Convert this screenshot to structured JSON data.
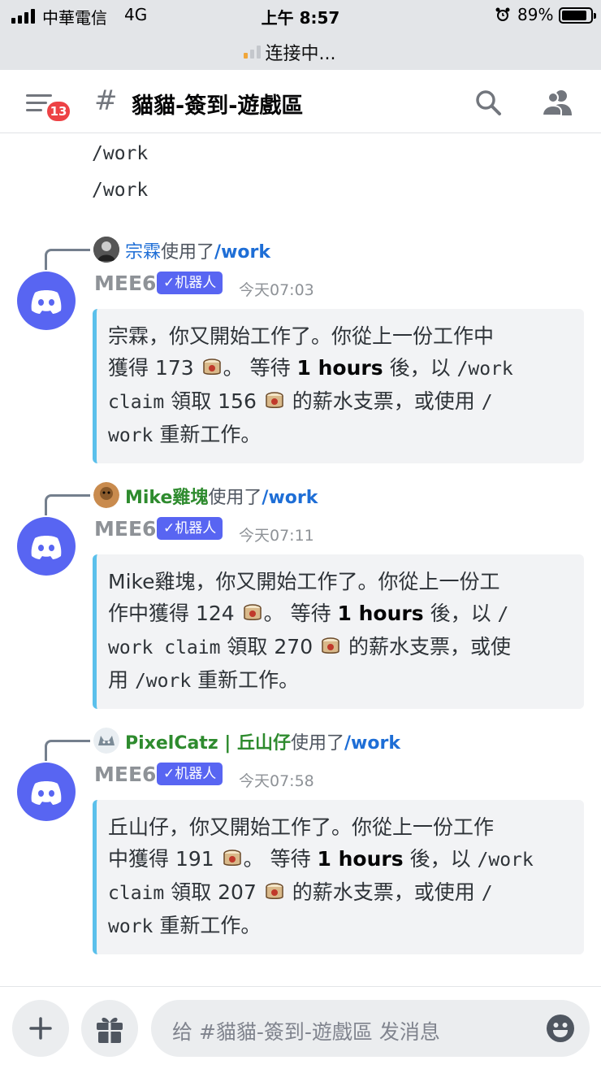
{
  "status_bar": {
    "carrier": "中華電信",
    "network": "4G",
    "time": "上午 8:57",
    "battery": "89%",
    "battery_level": 0.89,
    "connection_status": "连接中..."
  },
  "header": {
    "unread_badge": "13",
    "channel_hash": "#",
    "channel_name": "貓貓-簽到-遊戲區"
  },
  "earlier_messages": [
    "/work",
    "/work"
  ],
  "messages": [
    {
      "reply_user": "宗霖",
      "reply_user_color": "#1e6ed6",
      "reply_used": "使用了",
      "reply_command": "/work",
      "author": "MEE6",
      "bot_tag": "✓机器人",
      "timestamp": "今天07:03",
      "lines": {
        "l1": "宗霖，你又開始工作了。你從上一份工作中",
        "l2a": "獲得 173 ",
        "l2b": "。 等待 ",
        "l2c": "1 hours",
        "l2d": " 後，以 ",
        "l2e": "/work",
        "l3a": "claim",
        "l3b": " 領取 156 ",
        "l3c": " 的薪水支票，或使用 ",
        "l3d": "/",
        "l4a": "work",
        "l4b": " 重新工作。"
      }
    },
    {
      "reply_user": "Mike雞塊",
      "reply_user_color": "#2e8b2e",
      "reply_used": "使用了",
      "reply_command": "/work",
      "author": "MEE6",
      "bot_tag": "✓机器人",
      "timestamp": "今天07:11",
      "lines": {
        "l1": "Mike雞塊，你又開始工作了。你從上一份工",
        "l2a": "作中獲得 124 ",
        "l2b": "。 等待 ",
        "l2c": "1 hours",
        "l2d": " 後，以 ",
        "l2e": "/",
        "l3a": "work claim",
        "l3b": " 領取 270 ",
        "l3c": " 的薪水支票，或使",
        "l4a": "用 ",
        "l4b": "/work",
        "l4c": " 重新工作。"
      }
    },
    {
      "reply_user": "PixelCatz | 丘山仔",
      "reply_user_color": "#2e8b2e",
      "reply_used": "使用了",
      "reply_command": "/work",
      "author": "MEE6",
      "bot_tag": "✓机器人",
      "timestamp": "今天07:58",
      "lines": {
        "l1": "丘山仔，你又開始工作了。你從上一份工作",
        "l2a": "中獲得 191 ",
        "l2b": "。 等待 ",
        "l2c": "1 hours",
        "l2d": " 後，以 ",
        "l2e": "/work",
        "l3a": "claim",
        "l3b": " 領取 207 ",
        "l3c": " 的薪水支票，或使用 ",
        "l3d": "/",
        "l4a": "work",
        "l4b": " 重新工作。"
      }
    }
  ],
  "composer": {
    "placeholder": "给 #貓貓-簽到-遊戲區 发消息"
  },
  "icons": {
    "menu": "hamburger-menu-icon",
    "search": "search-icon",
    "members": "members-icon",
    "add": "plus-icon",
    "gift": "gift-icon",
    "emoji": "emoji-icon",
    "avatar": "discord-logo-icon",
    "currency": "drum-emoji-icon"
  },
  "colors": {
    "blurple": "#5865f2",
    "embed_accent": "#5bc0eb",
    "badge_red": "#ed4245",
    "command_blue": "#1e6ed6"
  }
}
